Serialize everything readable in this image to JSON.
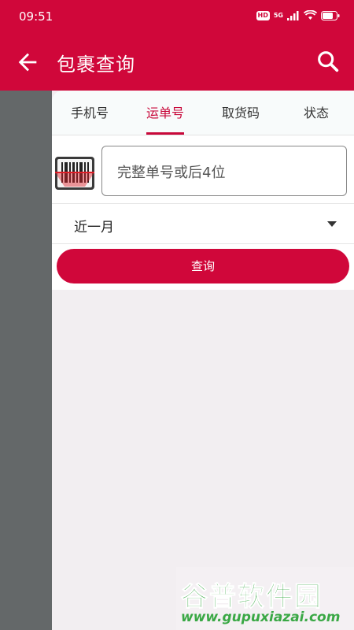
{
  "status_bar": {
    "time": "09:51",
    "hd": "HD",
    "network": "5G"
  },
  "app_bar": {
    "title": "包裹查询",
    "back_icon": "arrow-left-icon",
    "search_icon": "search-icon"
  },
  "tabs": [
    {
      "label": "手机号",
      "active": false
    },
    {
      "label": "运单号",
      "active": true
    },
    {
      "label": "取货码",
      "active": false
    },
    {
      "label": "状态",
      "active": false
    }
  ],
  "tracking_input": {
    "placeholder": "完整单号或后4位",
    "scan_icon": "barcode-scan-icon"
  },
  "date_range": {
    "selected": "近一月"
  },
  "query_button": {
    "label": "查询"
  },
  "watermark": {
    "title": "谷普软件园",
    "url": "www.gupuxiazai.com"
  },
  "colors": {
    "brand": "#d0073a",
    "background": "#f2eef1",
    "side": "#646869"
  }
}
